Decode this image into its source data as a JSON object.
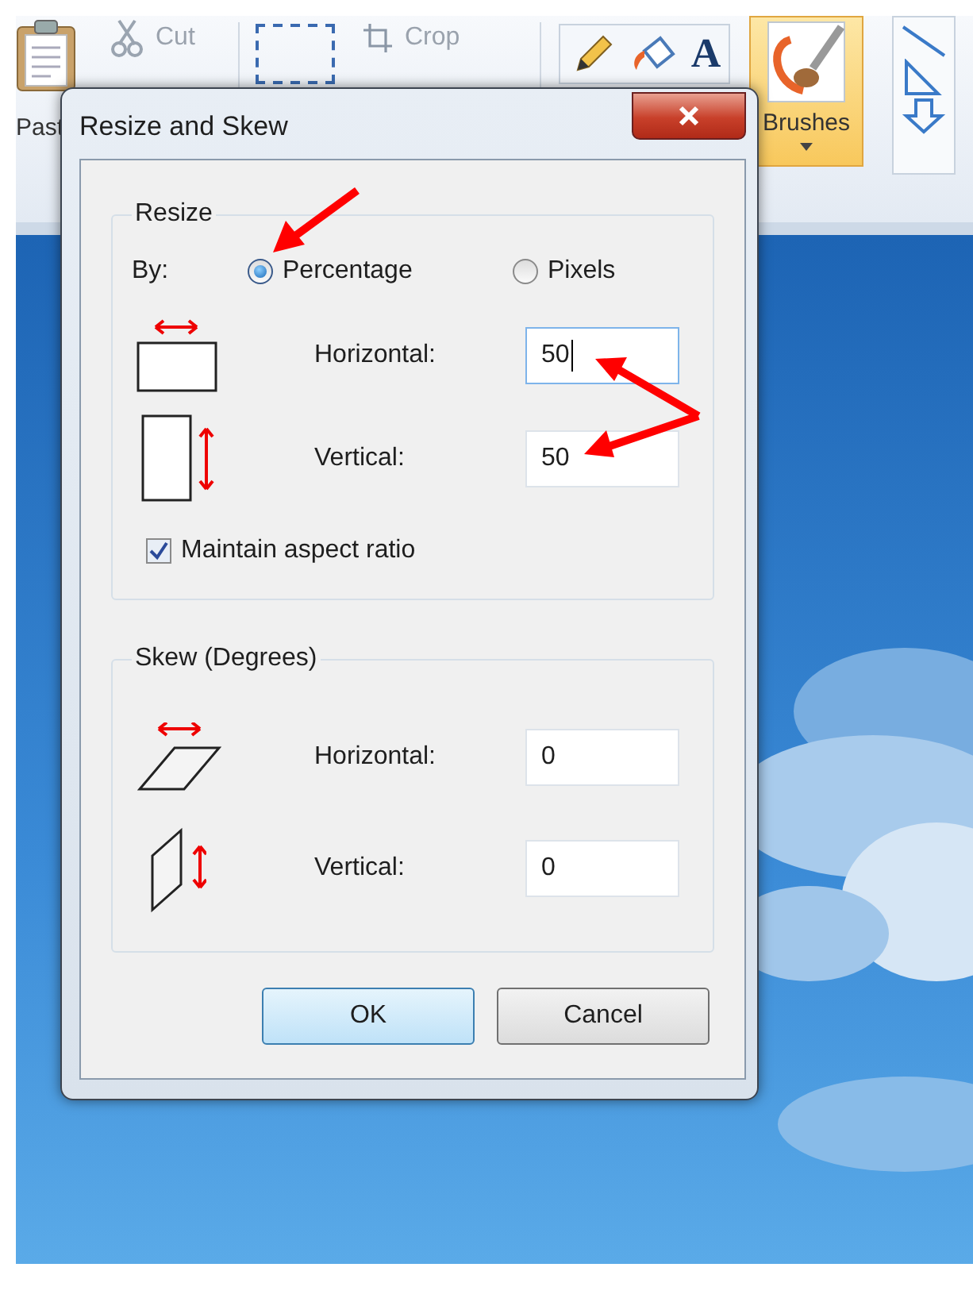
{
  "ribbon": {
    "paste_label": "Past",
    "cut_label": "Cut",
    "crop_label": "Crop",
    "text_tool_glyph": "A",
    "brushes": {
      "label": "Brushes",
      "selected": true
    }
  },
  "dialog": {
    "title": "Resize and Skew",
    "resize": {
      "title": "Resize",
      "by_label": "By:",
      "options": [
        {
          "label": "Percentage",
          "selected": true
        },
        {
          "label": "Pixels",
          "selected": false
        }
      ],
      "fields": [
        {
          "kind": "horizontal",
          "label": "Horizontal:",
          "value": "50",
          "focused": true
        },
        {
          "kind": "vertical",
          "label": "Vertical:",
          "value": "50",
          "focused": false
        }
      ],
      "maintain_aspect": {
        "label": "Maintain aspect ratio",
        "checked": true
      }
    },
    "skew": {
      "title": "Skew (Degrees)",
      "fields": [
        {
          "kind": "horizontal",
          "label": "Horizontal:",
          "value": "0",
          "focused": false
        },
        {
          "kind": "vertical",
          "label": "Vertical:",
          "value": "0",
          "focused": false
        }
      ]
    },
    "buttons": [
      {
        "label": "OK",
        "default": true
      },
      {
        "label": "Cancel",
        "default": false
      }
    ]
  }
}
